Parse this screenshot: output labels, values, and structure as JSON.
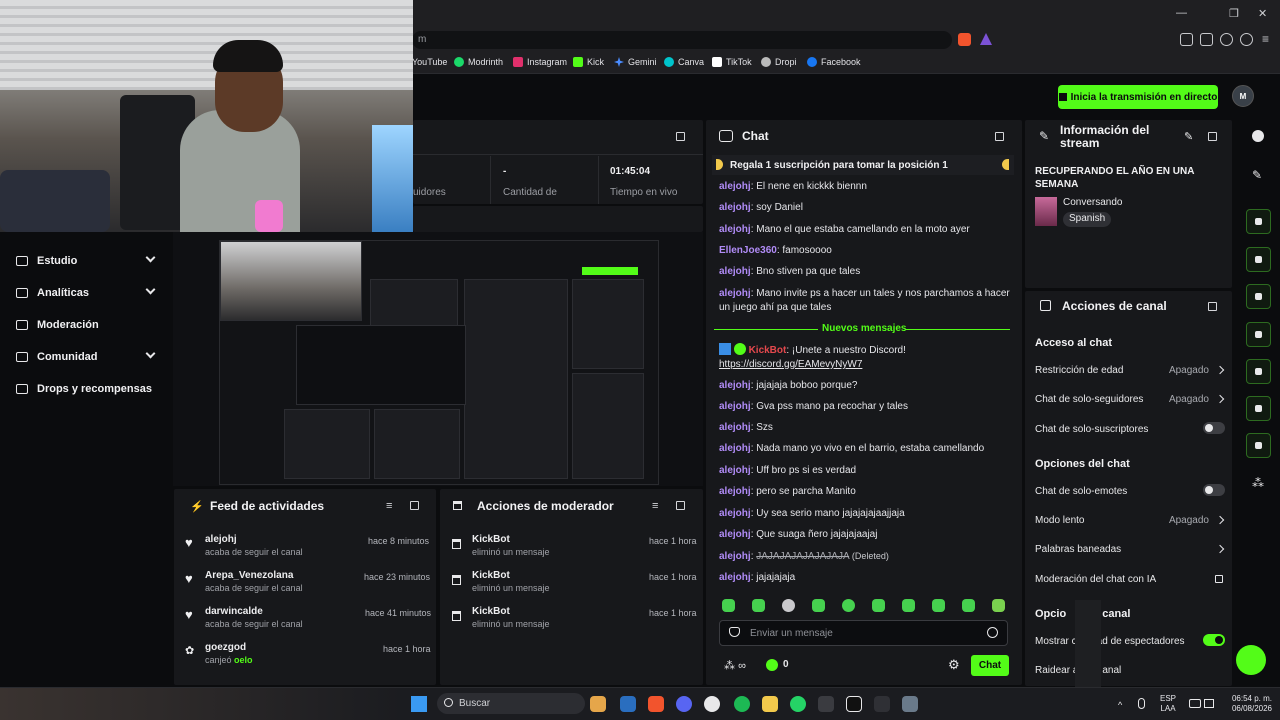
{
  "browser": {
    "address_fragment": "m",
    "bookmarks": [
      {
        "label": "YouTube",
        "color": "#ff0000"
      },
      {
        "label": "Modrinth",
        "color": "#1bd96a"
      },
      {
        "label": "Instagram",
        "color": "#e1306c"
      },
      {
        "label": "Kick",
        "color": "#53fc18"
      },
      {
        "label": "Gemini",
        "color": "#4a8cff"
      },
      {
        "label": "Canva",
        "color": "#00c4cc"
      },
      {
        "label": "TikTok",
        "color": "#ffffff"
      },
      {
        "label": "Dropi",
        "color": "#bbbbbb"
      },
      {
        "label": "Facebook",
        "color": "#1877f2"
      }
    ]
  },
  "header": {
    "go_live_label": "Inicia la transmisión en directo",
    "avatar_initials": "M"
  },
  "stats": {
    "followers_label": "uidores",
    "count_value": "-",
    "count_label": "Cantidad de",
    "live_time_value": "01:45:04",
    "live_time_label": "Tiempo en vivo"
  },
  "nav": {
    "items": [
      {
        "label": "Estudio",
        "has_chevron": true
      },
      {
        "label": "Analíticas",
        "has_chevron": true
      },
      {
        "label": "Moderación",
        "has_chevron": false
      },
      {
        "label": "Comunidad",
        "has_chevron": true
      },
      {
        "label": "Drops y recompensas",
        "has_chevron": false
      }
    ]
  },
  "feed": {
    "title": "Feed de actividades",
    "items": [
      {
        "name": "alejohj",
        "detail": "acaba de seguir el canal",
        "time": "hace 8 minutos"
      },
      {
        "name": "Arepa_Venezolana",
        "detail": "acaba de seguir el canal",
        "time": "hace 23 minutos"
      },
      {
        "name": "darwincalde",
        "detail": "acaba de seguir el canal",
        "time": "hace 41 minutos"
      },
      {
        "name": "goezgod",
        "detail_prefix": "canjeó",
        "detail_highlight": "oelo",
        "time": "hace 1 hora"
      }
    ]
  },
  "mod_actions": {
    "title": "Acciones de moderador",
    "items": [
      {
        "name": "KickBot",
        "detail": "eliminó un mensaje",
        "time": "hace 1 hora"
      },
      {
        "name": "KickBot",
        "detail": "eliminó un mensaje",
        "time": "hace 1 hora"
      },
      {
        "name": "KickBot",
        "detail": "eliminó un mensaje",
        "time": "hace 1 hora"
      }
    ]
  },
  "chat": {
    "title": "Chat",
    "pinned": "Regala 1 suscripción para tomar la posición 1",
    "new_messages_label": "Nuevos mensajes",
    "messages": [
      {
        "user": "alejohj",
        "text": "El nene en kickkk biennn"
      },
      {
        "user": "alejohj",
        "text": "soy Daniel"
      },
      {
        "user": "alejohj",
        "text": "Mano el que estaba camellando en la moto ayer"
      },
      {
        "user": "EllenJoe360",
        "text": "famosoooo"
      },
      {
        "user": "alejohj",
        "text": "Bno stiven pa que tales"
      },
      {
        "user": "alejohj",
        "text": "Mano invite ps a hacer un tales y nos parchamos a hacer un juego ahí pa que tales"
      },
      {
        "user": "alejohj",
        "text": "jajajaja boboo porque?"
      },
      {
        "user": "alejohj",
        "text": "Gva pss mano pa recochar y tales"
      },
      {
        "user": "alejohj",
        "text": "Szs"
      },
      {
        "user": "alejohj",
        "text": "Nada mano yo vivo en el barrio, estaba camellando"
      },
      {
        "user": "alejohj",
        "text": "Uff bro ps si es verdad"
      },
      {
        "user": "alejohj",
        "text": "pero se parcha Manito"
      },
      {
        "user": "alejohj",
        "text": "Uy sea serio mano jajajajajaajjaja"
      },
      {
        "user": "alejohj",
        "text": "Que suaga ñero jajajajaajaj"
      },
      {
        "user": "alejohj",
        "text": "JAJAJAJAJAJAJAJA",
        "deleted_label": "(Deleted)"
      },
      {
        "user": "alejohj",
        "text": "jajajajaja"
      }
    ],
    "bot_message": {
      "user": "KickBot",
      "text": "¡Unete a nuestro Discord!",
      "link": "https://discord.gg/EAMevyNyW7"
    },
    "input_placeholder": "Enviar un mensaje",
    "infinity_label": "∞",
    "points_value": "0",
    "send_label": "Chat"
  },
  "stream_info": {
    "title": "Información del stream",
    "stream_title": "RECUPERANDO EL AÑO EN UNA SEMANA",
    "category": "Conversando",
    "language": "Spanish"
  },
  "channel_actions": {
    "title": "Acciones de canal",
    "chat_access_title": "Acceso al chat",
    "age_restriction": {
      "label": "Restricción de edad",
      "value": "Apagado"
    },
    "followers_only": {
      "label": "Chat de solo-seguidores",
      "value": "Apagado"
    },
    "subs_only": {
      "label": "Chat de solo-suscriptores",
      "enabled": false
    },
    "chat_options_title": "Opciones del chat",
    "emotes_only": {
      "label": "Chat de solo-emotes",
      "enabled": false
    },
    "slow_mode": {
      "label": "Modo lento",
      "value": "Apagado"
    },
    "banned_words": {
      "label": "Palabras baneadas"
    },
    "ai_moderation": {
      "label": "Moderación del chat con IA"
    },
    "channel_options_title": "Opcio",
    "channel_options_title_tail": "l canal",
    "show_viewers": {
      "label_start": "Mostrar c",
      "label_end": "ad de espectadores",
      "enabled": true
    },
    "raid": {
      "label_start": "Raidear a",
      "label_end": "anal"
    }
  },
  "taskbar": {
    "search_label": "Buscar",
    "lang_line1": "ESP",
    "lang_line2": "LAA",
    "time": "06:54 p. m.",
    "date": "06/08/2026"
  }
}
